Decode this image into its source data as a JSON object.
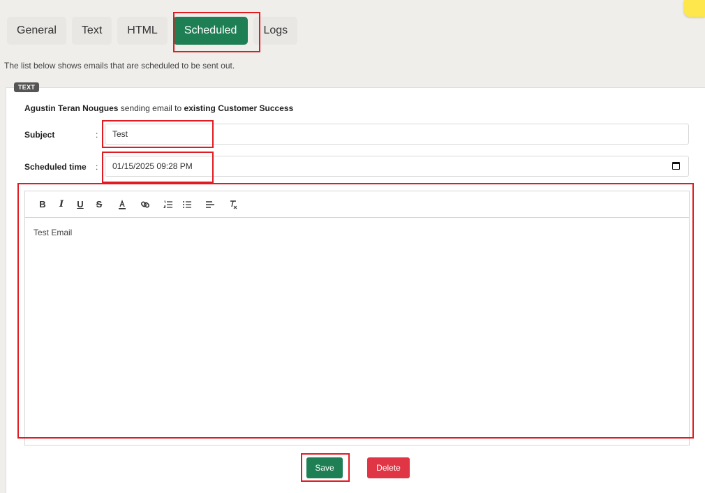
{
  "tabs": [
    {
      "label": "General"
    },
    {
      "label": "Text"
    },
    {
      "label": "HTML"
    },
    {
      "label": "Scheduled",
      "active": true
    },
    {
      "label": "Logs"
    }
  ],
  "description": "The list below shows emails that are scheduled to be sent out.",
  "badge": "TEXT",
  "sender": {
    "name": "Agustin Teran Nougues",
    "middle": " sending email to ",
    "recipient": "existing Customer Success"
  },
  "subject": {
    "label": "Subject",
    "colon": ":",
    "value": "Test"
  },
  "scheduled_time": {
    "label": "Scheduled time",
    "colon": ":",
    "value": "01/15/2025 09:28 PM"
  },
  "editor": {
    "toolbar": [
      "bold-icon",
      "italic-icon",
      "underline-icon",
      "strikethrough-icon",
      "text-color-icon",
      "link-icon",
      "ordered-list-icon",
      "bullet-list-icon",
      "align-icon",
      "clear-format-icon"
    ],
    "content": "Test Email"
  },
  "buttons": {
    "save": "Save",
    "delete": "Delete"
  },
  "colors": {
    "accent": "#1d7f53",
    "danger": "#e03545",
    "highlight": "#e11b22"
  }
}
